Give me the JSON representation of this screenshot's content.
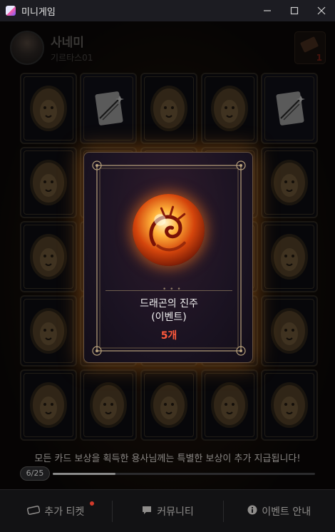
{
  "window": {
    "title": "미니게임",
    "minimize_icon": "minimize-icon",
    "maximize_icon": "maximize-icon",
    "close_icon": "close-icon"
  },
  "header": {
    "user_name": "사네미",
    "server": "기르타스01",
    "ticket_count": "1"
  },
  "grid": {
    "flipped_card_icon": "scroll-icon",
    "hidden_card_icon": "lion-crest-icon"
  },
  "popup": {
    "item_name_line1": "드래곤의 진주",
    "item_name_line2": "(이벤트)",
    "item_quantity": "5개",
    "item_icon": "dragon-pearl-icon"
  },
  "footer": {
    "notice": "모든 카드 보상을 획득한 용사님께는 특별한 보상이 추가 지급됩니다!",
    "progress_label": "6/25",
    "progress_value": 0.24
  },
  "bottom_bar": {
    "extra_ticket": "추가 티켓",
    "community": "커뮤니티",
    "event_info": "이벤트 안내"
  },
  "colors": {
    "accent_red": "#ff5a3c",
    "background": "#0b0b0f"
  }
}
